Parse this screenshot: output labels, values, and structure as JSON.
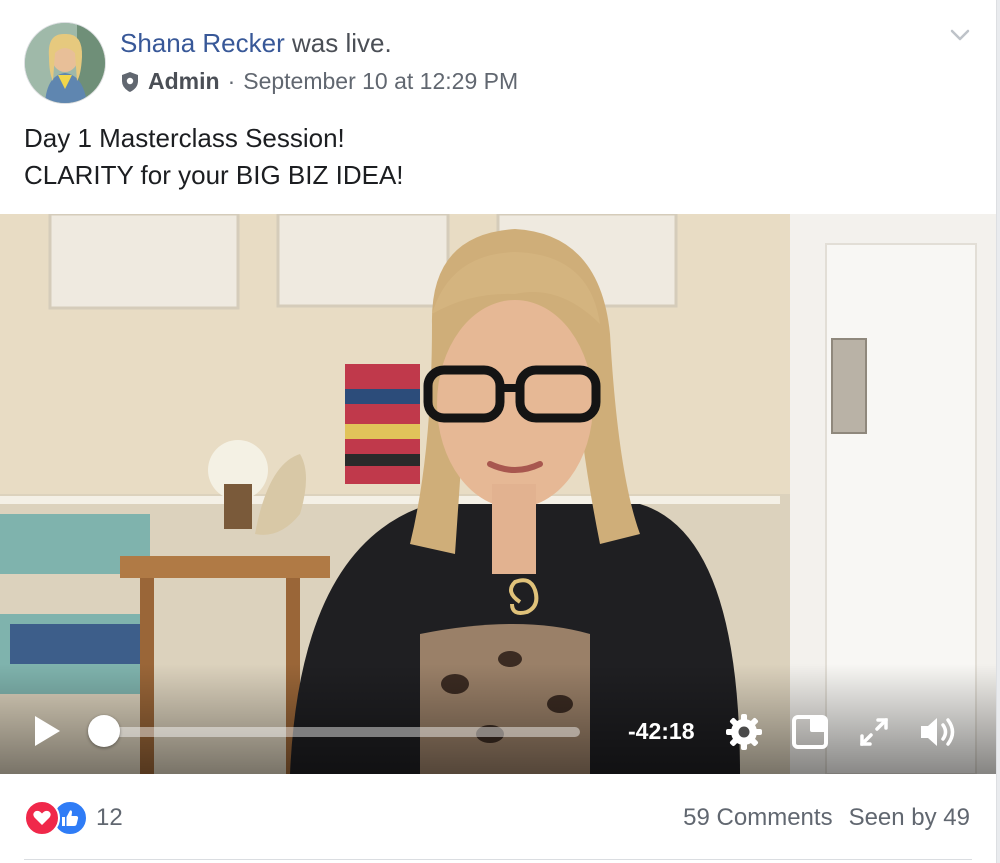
{
  "post": {
    "author_name": "Shana Recker",
    "action_text": "was live.",
    "role": "Admin",
    "separator": "·",
    "timestamp": "September 10 at 12:29 PM",
    "text_line1": "Day 1 Masterclass Session!",
    "text_line2": "CLARITY for your BIG BIZ IDEA!"
  },
  "video": {
    "time_remaining": "-42:18",
    "progress_fraction": 0.0,
    "icons": [
      "play-icon",
      "settings-gear-icon",
      "picture-in-picture-icon",
      "fullscreen-expand-icon",
      "volume-icon"
    ]
  },
  "footer": {
    "reaction_count": "12",
    "reaction_types": [
      "love-reaction-icon",
      "like-reaction-icon"
    ],
    "comments": "59 Comments",
    "seen_by": "Seen by 49"
  },
  "colors": {
    "link_blue": "#385898",
    "meta_gray": "#616770",
    "love_red": "#f0284a",
    "like_blue": "#2f7cf6"
  }
}
